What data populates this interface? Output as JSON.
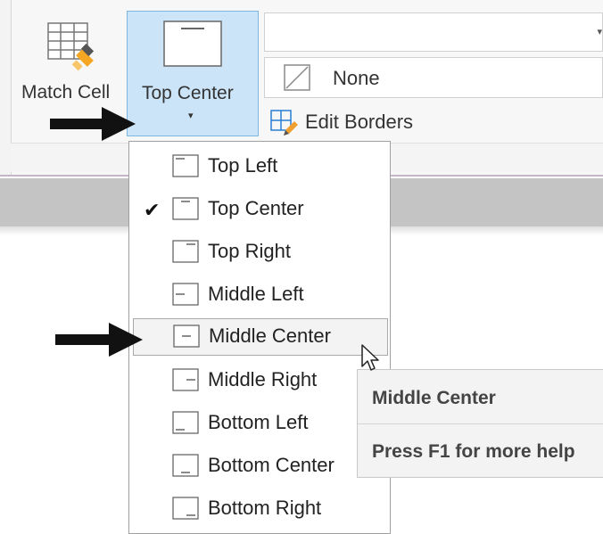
{
  "ribbon": {
    "match_cell_label": "Match Cell",
    "alignment_button_label": "Top Center",
    "border_style_value": "None",
    "edit_borders_label": "Edit Borders"
  },
  "alignment_menu": {
    "items": [
      {
        "label": "Top Left",
        "checked": false,
        "icon": "align-top-left-icon"
      },
      {
        "label": "Top Center",
        "checked": true,
        "icon": "align-top-center-icon"
      },
      {
        "label": "Top Right",
        "checked": false,
        "icon": "align-top-right-icon"
      },
      {
        "label": "Middle Left",
        "checked": false,
        "icon": "align-middle-left-icon"
      },
      {
        "label": "Middle Center",
        "checked": false,
        "hovered": true,
        "icon": "align-middle-center-icon"
      },
      {
        "label": "Middle Right",
        "checked": false,
        "icon": "align-middle-right-icon"
      },
      {
        "label": "Bottom Left",
        "checked": false,
        "icon": "align-bottom-left-icon"
      },
      {
        "label": "Bottom Center",
        "checked": false,
        "icon": "align-bottom-center-icon"
      },
      {
        "label": "Bottom Right",
        "checked": false,
        "icon": "align-bottom-right-icon"
      }
    ],
    "check_glyph": "✔"
  },
  "tooltip": {
    "title": "Middle Center",
    "help_text": "Press F1 for more help"
  },
  "colors": {
    "selected_button_bg": "#cce4f7",
    "selected_button_border": "#7cb6e3",
    "ribbon_separator": "#c8b4c8",
    "gray_bar": "#c4c4c4"
  }
}
